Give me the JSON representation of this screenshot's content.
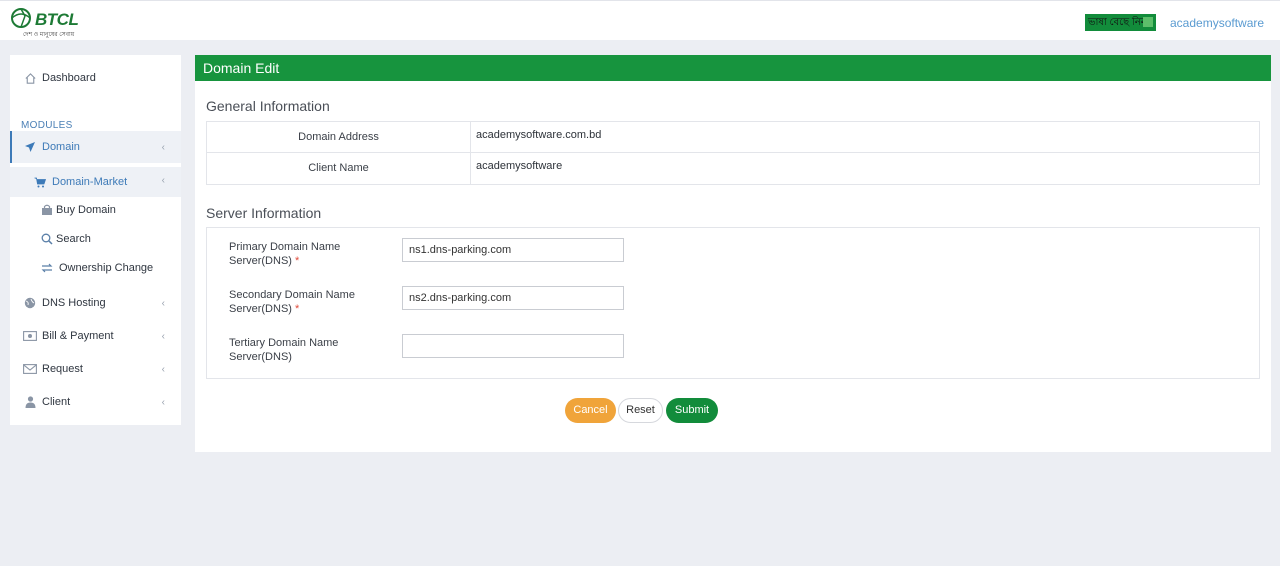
{
  "header": {
    "logo_text": "BTCL",
    "logo_tagline": "দেশ ও মানুষের সেবায়",
    "lang_button": "ভাষা বেছে নিন",
    "username": "academysoftware"
  },
  "sidebar": {
    "dashboard": "Dashboard",
    "modules_heading": "MODULES",
    "domain": "Domain",
    "domain_market": "Domain-Market",
    "buy_domain": "Buy Domain",
    "search": "Search",
    "ownership_change": "Ownership Change",
    "dns_hosting": "DNS Hosting",
    "bill_payment": "Bill & Payment",
    "request": "Request",
    "client": "Client"
  },
  "page": {
    "title": "Domain Edit",
    "general_heading": "General Information",
    "domain_address_label": "Domain Address",
    "domain_address_value": "academysoftware.com.bd",
    "client_name_label": "Client Name",
    "client_name_value": "academysoftware",
    "server_heading": "Server Information",
    "primary_dns_label": "Primary Domain Name Server(DNS)",
    "primary_dns_value": "ns1.dns-parking.com",
    "secondary_dns_label": "Secondary Domain Name Server(DNS)",
    "secondary_dns_value": "ns2.dns-parking.com",
    "tertiary_dns_label": "Tertiary Domain Name Server(DNS)",
    "tertiary_dns_value": "",
    "required_mark": "*",
    "cancel_label": "Cancel",
    "reset_label": "Reset",
    "submit_label": "Submit"
  },
  "colors": {
    "header_green": "#17943e",
    "link_blue": "#5a9bd1",
    "cancel_orange": "#f0a43a",
    "submit_green": "#128c3b"
  }
}
